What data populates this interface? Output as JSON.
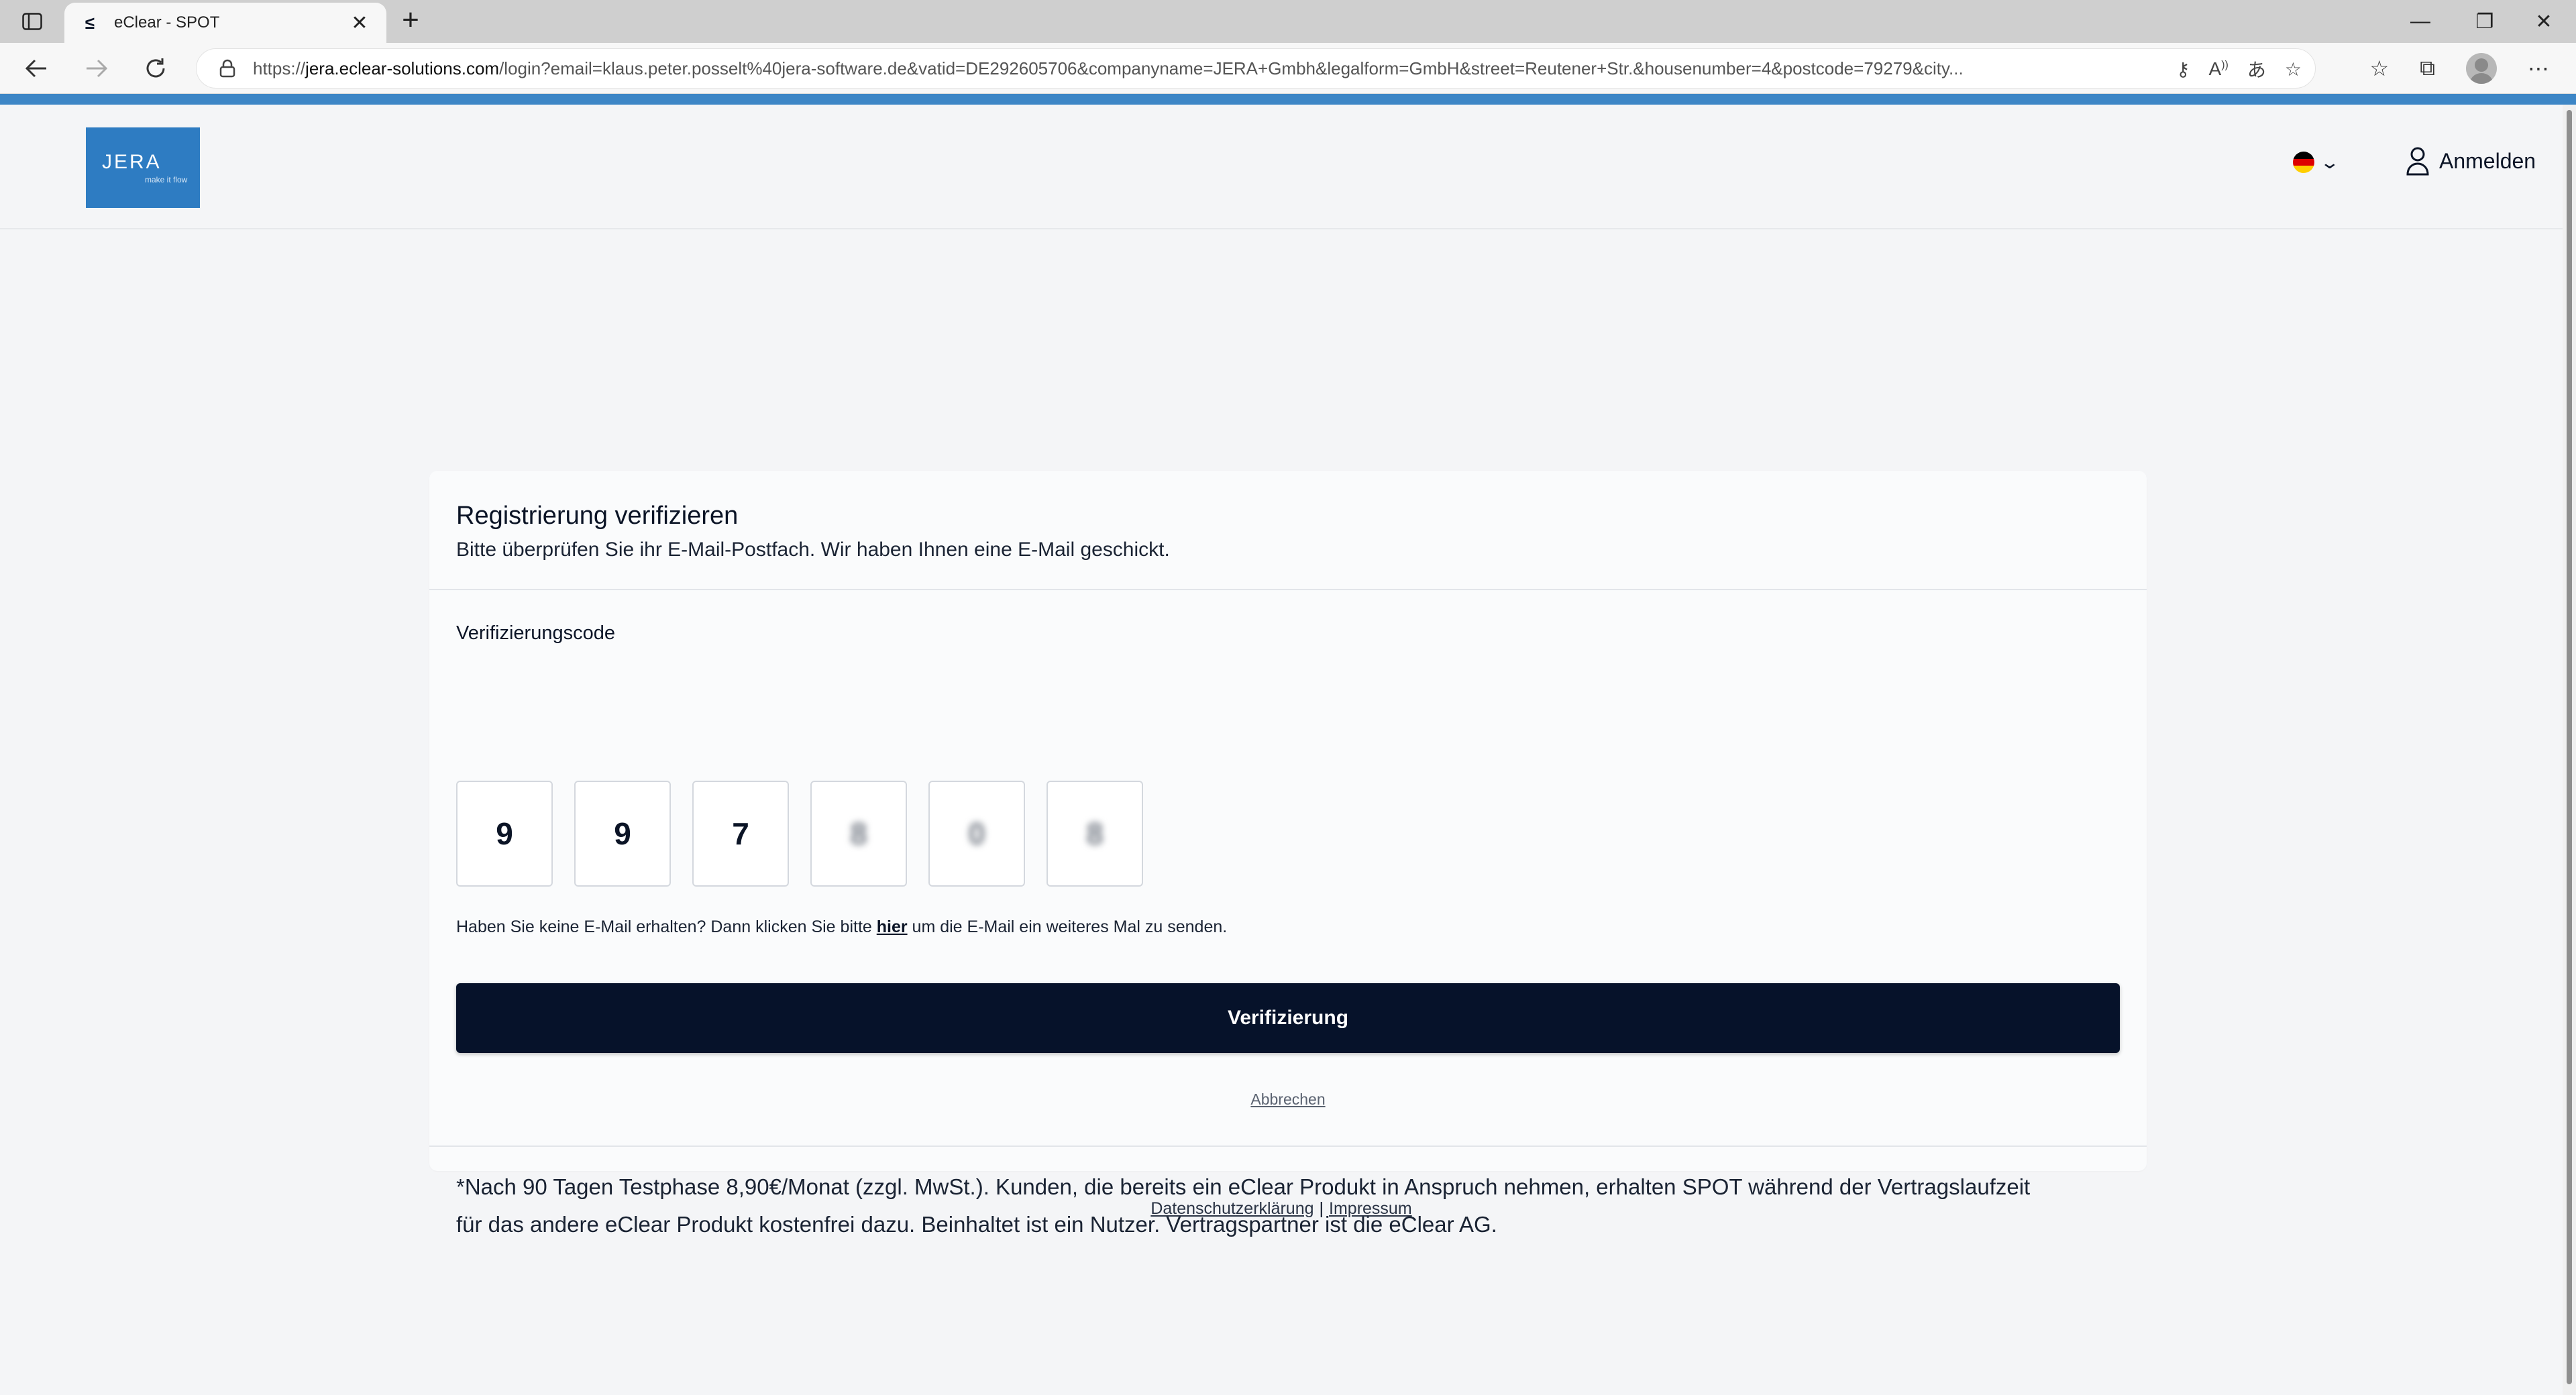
{
  "browser": {
    "tab_title": "eClear - SPOT",
    "tab_close": "✕",
    "new_tab": "+",
    "url_prefix": "https://",
    "url_host": "jera.eclear-solutions.com",
    "url_rest": "/login?email=klaus.peter.posselt%40jera-software.de&vatid=DE292605706&companyname=JERA+Gmbh&legalform=GmbH&street=Reutener+Str.&housenumber=4&postcode=79279&city...",
    "window_minimize": "—",
    "window_restore": "❐",
    "window_close": "✕"
  },
  "header": {
    "logo_text": "JERA",
    "logo_tagline": "make it flow",
    "language_colors": [
      "#000000",
      "#dd0000",
      "#ffce00"
    ],
    "login_label": "Anmelden"
  },
  "card": {
    "title": "Registrierung verifizieren",
    "subtitle": "Bitte überprüfen Sie ihr E-Mail-Postfach. Wir haben Ihnen eine E-Mail geschickt.",
    "code_label": "Verifizierungscode",
    "code_digits": [
      "9",
      "9",
      "7",
      "8",
      "0",
      "8"
    ],
    "resend_before": "Haben Sie keine E-Mail erhalten? Dann klicken Sie bitte ",
    "resend_link": "hier",
    "resend_after": " um die E-Mail ein weiteres Mal zu senden.",
    "verify_button": "Verifizierung",
    "cancel_link": "Abbrechen",
    "note_line1": "*Nach 90 Tagen Testphase 8,90€/Monat (zzgl. MwSt.). Kunden, die bereits ein eClear Produkt in Anspruch nehmen, erhalten SPOT während der Vertragslaufzeit",
    "note_line2": "für das andere eClear Produkt kostenfrei dazu. Beinhaltet ist ein Nutzer. Vertragspartner ist die eClear AG."
  },
  "footer": {
    "privacy": "Datenschutzerklärung",
    "separator": "|",
    "imprint": "Impressum"
  },
  "colors": {
    "accent_strip": "#3d86c6",
    "primary_button": "#06122a",
    "logo_bg": "#2e7cc2"
  }
}
